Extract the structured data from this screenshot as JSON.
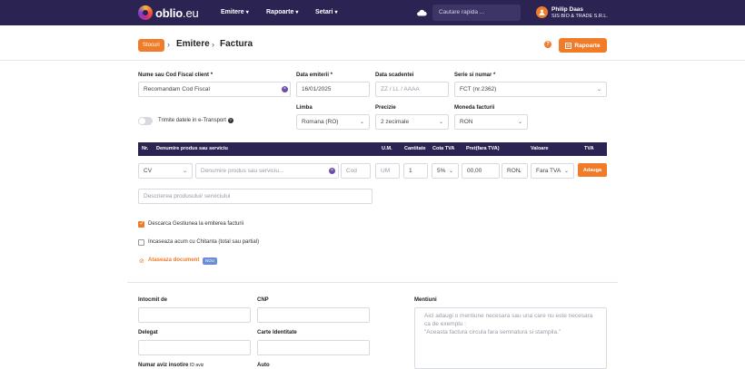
{
  "nav": {
    "logo_main": "oblio",
    "logo_suffix": ".eu",
    "menu": [
      "Emitere",
      "Rapoarte",
      "Setari"
    ],
    "search_placeholder": "Cautare rapida ...",
    "user_name": "Philip Daas",
    "user_company": "SIS BIO & TRADE S.R.L."
  },
  "breadcrumb": {
    "badge": "Stocuri",
    "items": [
      "Emitere",
      "Factura"
    ]
  },
  "actions": {
    "help": "?",
    "rapoarte_label": "Rapoarte"
  },
  "form": {
    "client_label": "Nume sau Cod Fiscal client *",
    "client_value": "Recomandam Cod Fiscal",
    "issue_date_label": "Data emiterii *",
    "issue_date_value": "16/01/2025",
    "due_date_label": "Data scadentei",
    "due_date_placeholder": "ZZ / LL / AAAA",
    "series_label": "Serie si numar *",
    "series_value": "FCT (nr.2362)",
    "language_label": "Limba",
    "language_value": "Romana (RO)",
    "precision_label": "Precizie",
    "precision_value": "2 zecimale",
    "currency_label": "Moneda facturii",
    "currency_value": "RON",
    "etransport_label": "Trimite datele in e-Transport"
  },
  "table": {
    "headers": [
      "Nr.",
      "Denumire produs sau serviciu",
      "U.M.",
      "Cantitate",
      "Cota TVA",
      "Pret(fara TVA)",
      "Valoare",
      "TVA"
    ],
    "row": {
      "type": "CV",
      "name_placeholder": "Denumire produs sau serviciu...",
      "code_placeholder": "Cod",
      "um_placeholder": "UM",
      "quantity": "1",
      "vat": "5%",
      "price": "00,00",
      "currency": "RON",
      "vat_mode": "Fara TVA",
      "add_label": "Adauga"
    },
    "description_placeholder": "Descrierea produsului/ serviciului"
  },
  "options": {
    "discharge_label": "Descarca Gestiunea la emiterea facturii",
    "collect_label": "Incaseaza acum cu Chitanta (total sau partial)",
    "attach_label": "Ataseaza document",
    "attach_badge": "NOU"
  },
  "bottom": {
    "issued_by_label": "Intocmit de",
    "cnp_label": "CNP",
    "mentions_label": "Mentiuni",
    "mentions_placeholder_1": "Aici adaugi o mentiune necesara sau una care nu este necesara",
    "mentions_placeholder_2": "ca de exemplu :",
    "mentions_placeholder_3": "\"Aceasta factura circula fara semnatura si stampila.\"",
    "delegate_label": "Delegat",
    "id_card_label": "Carte Identitate",
    "aviz_label": "Numar aviz insotire",
    "aviz_suffix": "ID aviz",
    "auto_label": "Auto"
  }
}
